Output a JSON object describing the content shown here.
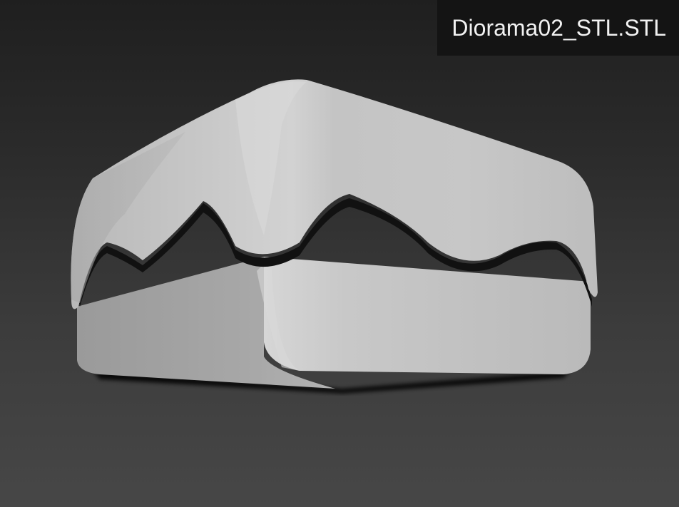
{
  "viewport": {
    "filename": "Diorama02_STL.STL",
    "model_icon": "stl-model-preview"
  }
}
